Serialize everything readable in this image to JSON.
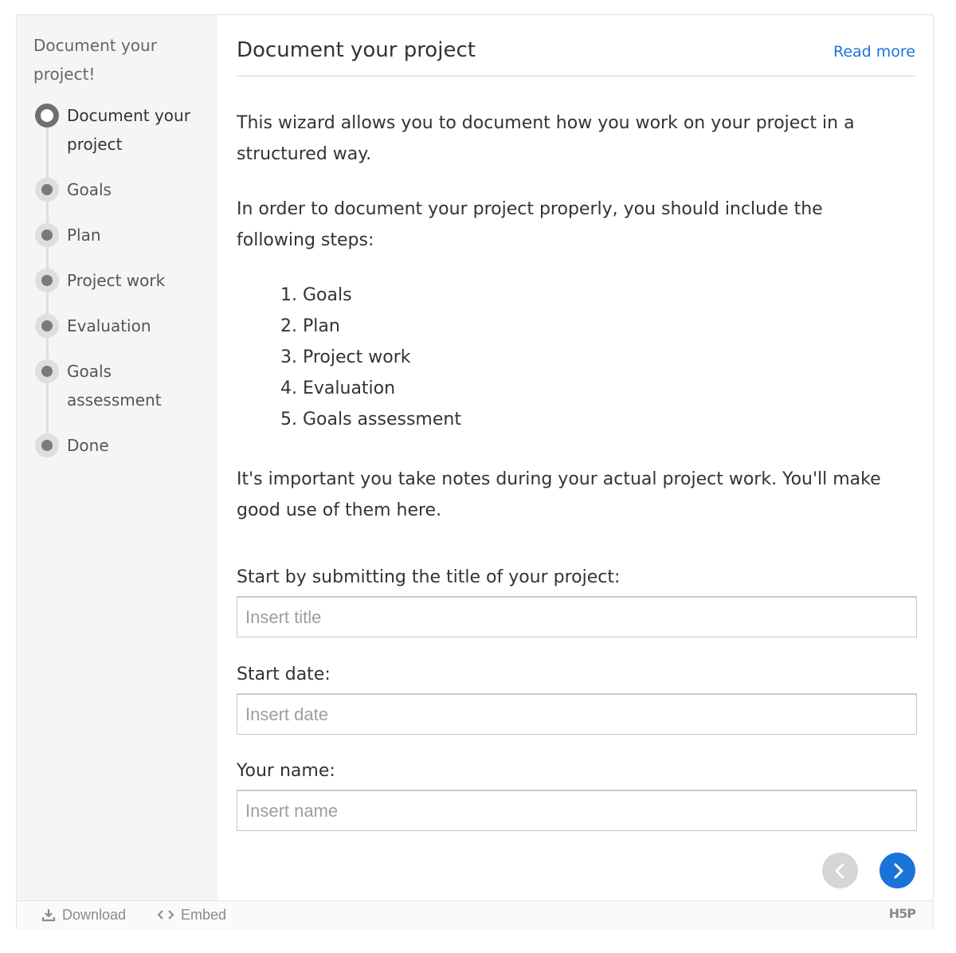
{
  "sidebar": {
    "title": "Document your project!",
    "steps": [
      {
        "label": "Document your project",
        "current": true
      },
      {
        "label": "Goals"
      },
      {
        "label": "Plan"
      },
      {
        "label": "Project work"
      },
      {
        "label": "Evaluation"
      },
      {
        "label": "Goals assessment"
      },
      {
        "label": "Done"
      }
    ]
  },
  "main": {
    "title": "Document your project",
    "read_more": "Read more",
    "intro": "This wizard allows you to document how you work on your project in a structured way.",
    "order_text": "In order to document your project properly, you should include the following steps:",
    "step_list": [
      "1. Goals",
      "2. Plan",
      "3. Project work",
      "4. Evaluation",
      "5. Goals assessment"
    ],
    "notes_text": "It's important you take notes during your actual project work. You'll make good use of them here.",
    "fields": {
      "title": {
        "label": "Start by submitting the title of your project:",
        "placeholder": "Insert title",
        "value": ""
      },
      "date": {
        "label": "Start date:",
        "placeholder": "Insert date",
        "value": ""
      },
      "name": {
        "label": "Your name:",
        "placeholder": "Insert name",
        "value": ""
      }
    }
  },
  "footer": {
    "download": "Download",
    "embed": "Embed",
    "logo": "H5P"
  },
  "colors": {
    "accent": "#1a73d9",
    "sidebar_bg": "#f5f5f5",
    "disabled_button": "#d6d6d6"
  },
  "icons": {
    "prev": "chevron-left-icon",
    "next": "chevron-right-icon",
    "download": "download-icon",
    "embed": "code-icon"
  }
}
